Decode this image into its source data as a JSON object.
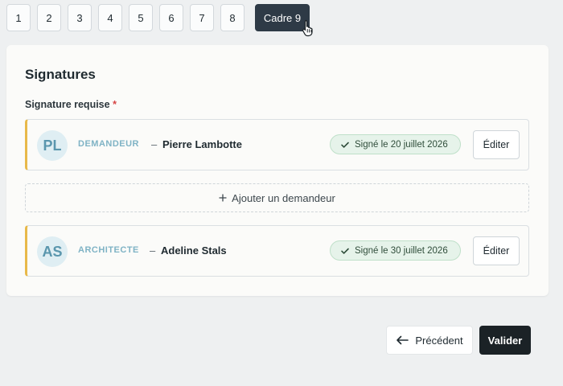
{
  "stepper": {
    "steps": [
      "1",
      "2",
      "3",
      "4",
      "5",
      "6",
      "7",
      "8"
    ],
    "current": "Cadre 9"
  },
  "section": {
    "title": "Signatures",
    "required_label": "Signature requise",
    "required_mark": "*"
  },
  "signers": [
    {
      "initials": "PL",
      "role": "DEMANDEUR",
      "separator": "–",
      "name": "Pierre Lambotte",
      "status": "Signé le 20 juillet 2026",
      "edit_label": "Éditer"
    },
    {
      "initials": "AS",
      "role": "ARCHITECTE",
      "separator": "–",
      "name": "Adeline Stals",
      "status": "Signé le 30 juillet 2026",
      "edit_label": "Éditer"
    }
  ],
  "add_requester": {
    "icon": "plus-icon",
    "label": "Ajouter un demandeur"
  },
  "footer": {
    "previous_icon": "arrow-left-icon",
    "previous_label": "Précédent",
    "submit_label": "Valider"
  },
  "colors": {
    "active_step": "#2e3a46",
    "row_accent": "#e8b94a",
    "status_bg": "#e6f3ea",
    "role_text": "#7fb3c5",
    "required": "#d64545",
    "primary_button": "#1b2226"
  }
}
